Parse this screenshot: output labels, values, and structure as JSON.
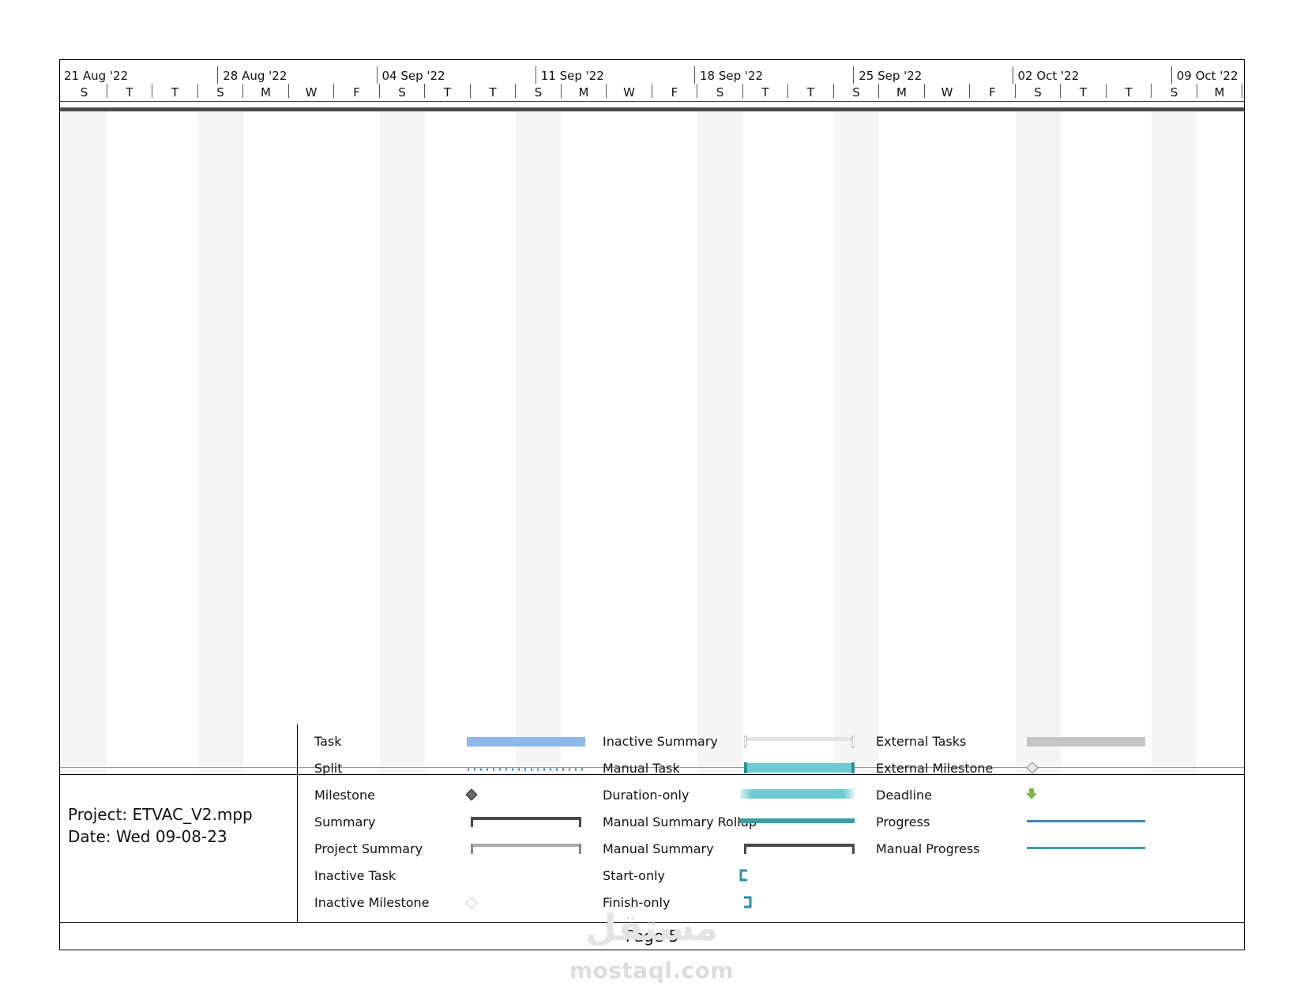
{
  "timescale": {
    "weeks": [
      "21 Aug '22",
      "28 Aug '22",
      "04 Sep '22",
      "11 Sep '22",
      "18 Sep '22",
      "25 Sep '22",
      "02 Oct '22",
      "09 Oct '22"
    ],
    "days": [
      "S",
      "T",
      "T",
      "S",
      "M",
      "W",
      "F",
      "S",
      "T",
      "T",
      "S",
      "M",
      "W",
      "F",
      "S",
      "T",
      "T",
      "S",
      "M",
      "W",
      "F",
      "S",
      "T",
      "T",
      "S",
      "M"
    ]
  },
  "project_info": {
    "project_line": "Project: ETVAC_V2.mpp",
    "date_line": "Date: Wed 09-08-23"
  },
  "legend": {
    "col1": [
      "Task",
      "Split",
      "Milestone",
      "Summary",
      "Project Summary",
      "Inactive Task",
      "Inactive Milestone"
    ],
    "col2": [
      "Inactive Summary",
      "Manual Task",
      "Duration-only",
      "Manual Summary Rollup",
      "Manual Summary",
      "Start-only",
      "Finish-only"
    ],
    "col3": [
      "External Tasks",
      "External Milestone",
      "Deadline",
      "Progress",
      "Manual Progress"
    ]
  },
  "colors": {
    "task": "#8db8e8",
    "split": "#3f7fb5",
    "manual_task": "#6fcbd1",
    "manual_rollup": "#3a9ea8",
    "summary": "#4a4a4a",
    "project_summary": "#aaaaaa",
    "external_task": "#c4c4c4",
    "deadline": "#7ab648",
    "progress": "#3f87b5",
    "manual_progress": "#3a9ea8",
    "nonworking": "#f5f5f5"
  },
  "footer": {
    "page": "Page 5"
  },
  "watermark": {
    "arabic": "مستقل",
    "latin": "mostaql.com"
  }
}
